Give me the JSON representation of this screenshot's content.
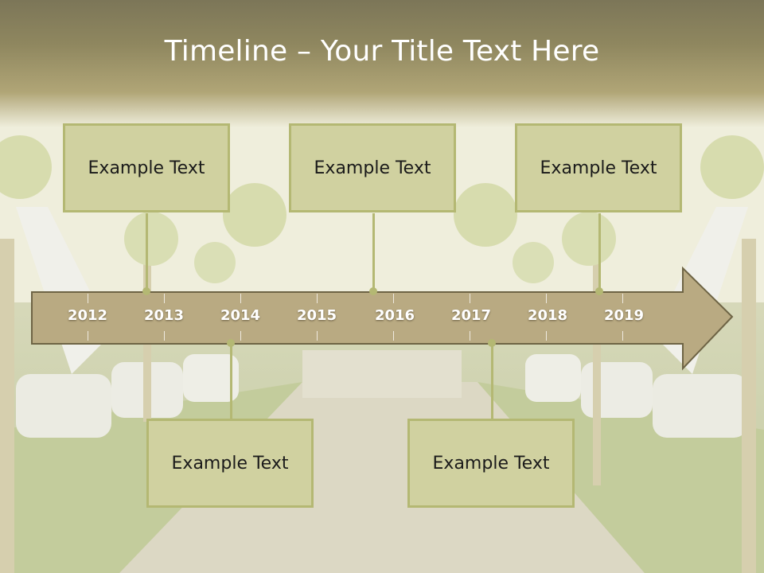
{
  "title": "Timeline – Your Title Text Here",
  "years": [
    "2012",
    "2013",
    "2014",
    "2015",
    "2016",
    "2017",
    "2018",
    "2019"
  ],
  "top_boxes": [
    {
      "label": "Example Text"
    },
    {
      "label": "Example Text"
    },
    {
      "label": "Example Text"
    }
  ],
  "bottom_boxes": [
    {
      "label": "Example Text"
    },
    {
      "label": "Example Text"
    }
  ],
  "colors": {
    "box_fill": "#d0d1a0",
    "box_border": "#b4b873",
    "arrow_fill": "#b9aa82",
    "arrow_stroke": "#6e6445",
    "title_color": "#ffffff"
  }
}
